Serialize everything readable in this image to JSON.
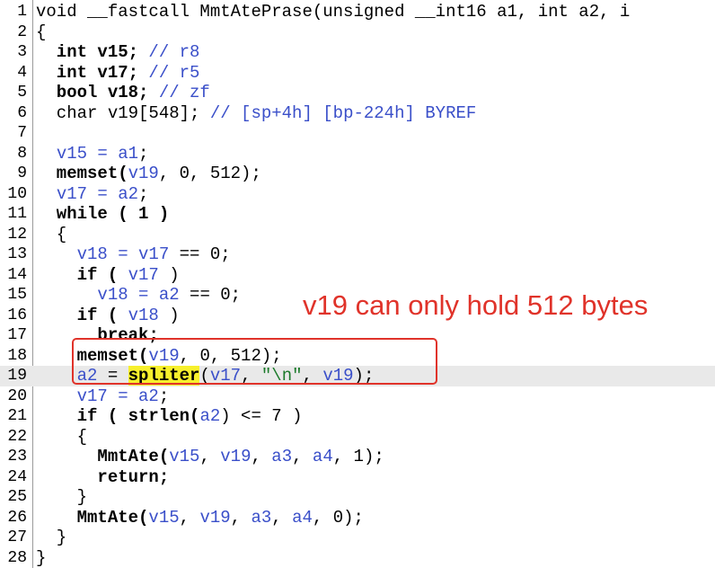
{
  "lines": [
    {
      "n": "1",
      "tokens": [
        {
          "t": "void __fastcall MmtAtePrase(unsigned __int16 a1, int a2, i",
          "c": "op"
        }
      ]
    },
    {
      "n": "2",
      "tokens": [
        {
          "t": "{",
          "c": "op"
        }
      ]
    },
    {
      "n": "3",
      "tokens": [
        {
          "t": "  int v15; ",
          "c": "kw"
        },
        {
          "t": "// r8",
          "c": "cmt"
        }
      ]
    },
    {
      "n": "4",
      "tokens": [
        {
          "t": "  int v17; ",
          "c": "kw"
        },
        {
          "t": "// r5",
          "c": "cmt"
        }
      ]
    },
    {
      "n": "5",
      "tokens": [
        {
          "t": "  bool v18; ",
          "c": "kw"
        },
        {
          "t": "// zf",
          "c": "cmt"
        }
      ]
    },
    {
      "n": "6",
      "tokens": [
        {
          "t": "  char v19[548]; ",
          "c": "op"
        },
        {
          "t": "// [sp+4h] [bp-224h] BYREF",
          "c": "cmt"
        }
      ]
    },
    {
      "n": "7",
      "tokens": [
        {
          "t": "",
          "c": "op"
        }
      ]
    },
    {
      "n": "8",
      "tokens": [
        {
          "t": "  ",
          "c": "op"
        },
        {
          "t": "v15 = a1",
          "c": "var"
        },
        {
          "t": ";",
          "c": "op"
        }
      ]
    },
    {
      "n": "9",
      "tokens": [
        {
          "t": "  memset(",
          "c": "fn"
        },
        {
          "t": "v19",
          "c": "var"
        },
        {
          "t": ", 0, 512);",
          "c": "op"
        }
      ]
    },
    {
      "n": "10",
      "tokens": [
        {
          "t": "  ",
          "c": "op"
        },
        {
          "t": "v17 = a2",
          "c": "var"
        },
        {
          "t": ";",
          "c": "op"
        }
      ]
    },
    {
      "n": "11",
      "tokens": [
        {
          "t": "  while ( 1 )",
          "c": "kw"
        }
      ]
    },
    {
      "n": "12",
      "tokens": [
        {
          "t": "  {",
          "c": "op"
        }
      ]
    },
    {
      "n": "13",
      "tokens": [
        {
          "t": "    ",
          "c": "op"
        },
        {
          "t": "v18 = v17",
          "c": "var"
        },
        {
          "t": " == 0;",
          "c": "op"
        }
      ]
    },
    {
      "n": "14",
      "tokens": [
        {
          "t": "    if ( ",
          "c": "kw"
        },
        {
          "t": "v17",
          "c": "var"
        },
        {
          "t": " )",
          "c": "op"
        }
      ]
    },
    {
      "n": "15",
      "tokens": [
        {
          "t": "      ",
          "c": "op"
        },
        {
          "t": "v18 = a2",
          "c": "var"
        },
        {
          "t": " == 0;",
          "c": "op"
        }
      ]
    },
    {
      "n": "16",
      "tokens": [
        {
          "t": "    if ( ",
          "c": "kw"
        },
        {
          "t": "v18",
          "c": "var"
        },
        {
          "t": " )",
          "c": "op"
        }
      ]
    },
    {
      "n": "17",
      "tokens": [
        {
          "t": "      break;",
          "c": "kw"
        }
      ]
    },
    {
      "n": "18",
      "tokens": [
        {
          "t": "    memset(",
          "c": "fn"
        },
        {
          "t": "v19",
          "c": "var"
        },
        {
          "t": ", 0, 512);",
          "c": "op"
        }
      ]
    },
    {
      "n": "19",
      "highlight": true,
      "tokens": [
        {
          "t": "    ",
          "c": "op"
        },
        {
          "t": "a2",
          "c": "var"
        },
        {
          "t": " = ",
          "c": "op"
        },
        {
          "t": "spliter",
          "c": "fn hl-word"
        },
        {
          "t": "(",
          "c": "op"
        },
        {
          "t": "v17",
          "c": "var"
        },
        {
          "t": ", ",
          "c": "op"
        },
        {
          "t": "\"\\n\"",
          "c": "str"
        },
        {
          "t": ", ",
          "c": "op"
        },
        {
          "t": "v19",
          "c": "var"
        },
        {
          "t": ");",
          "c": "op"
        }
      ]
    },
    {
      "n": "20",
      "tokens": [
        {
          "t": "    ",
          "c": "op"
        },
        {
          "t": "v17 = a2",
          "c": "var"
        },
        {
          "t": ";",
          "c": "op"
        }
      ]
    },
    {
      "n": "21",
      "tokens": [
        {
          "t": "    if ( strlen(",
          "c": "kw"
        },
        {
          "t": "a2",
          "c": "var"
        },
        {
          "t": ") <= 7 )",
          "c": "op"
        }
      ]
    },
    {
      "n": "22",
      "tokens": [
        {
          "t": "    {",
          "c": "op"
        }
      ]
    },
    {
      "n": "23",
      "tokens": [
        {
          "t": "      MmtAte(",
          "c": "fn"
        },
        {
          "t": "v15",
          "c": "var"
        },
        {
          "t": ", ",
          "c": "op"
        },
        {
          "t": "v19",
          "c": "var"
        },
        {
          "t": ", ",
          "c": "op"
        },
        {
          "t": "a3",
          "c": "var"
        },
        {
          "t": ", ",
          "c": "op"
        },
        {
          "t": "a4",
          "c": "var"
        },
        {
          "t": ", 1);",
          "c": "op"
        }
      ]
    },
    {
      "n": "24",
      "tokens": [
        {
          "t": "      return;",
          "c": "kw"
        }
      ]
    },
    {
      "n": "25",
      "tokens": [
        {
          "t": "    }",
          "c": "op"
        }
      ]
    },
    {
      "n": "26",
      "tokens": [
        {
          "t": "    MmtAte(",
          "c": "fn"
        },
        {
          "t": "v15",
          "c": "var"
        },
        {
          "t": ", ",
          "c": "op"
        },
        {
          "t": "v19",
          "c": "var"
        },
        {
          "t": ", ",
          "c": "op"
        },
        {
          "t": "a3",
          "c": "var"
        },
        {
          "t": ", ",
          "c": "op"
        },
        {
          "t": "a4",
          "c": "var"
        },
        {
          "t": ", 0);",
          "c": "op"
        }
      ]
    },
    {
      "n": "27",
      "tokens": [
        {
          "t": "  }",
          "c": "op"
        }
      ]
    },
    {
      "n": "28",
      "tokens": [
        {
          "t": "}",
          "c": "op"
        }
      ]
    }
  ],
  "annotation": {
    "text": "v19 can only hold 512 bytes",
    "color": "#e0332a"
  },
  "colors": {
    "variable": "#3a4fc9",
    "string": "#1b7a2a",
    "highlight_word": "#f7f02c",
    "highlight_line": "#e9e9e9"
  }
}
